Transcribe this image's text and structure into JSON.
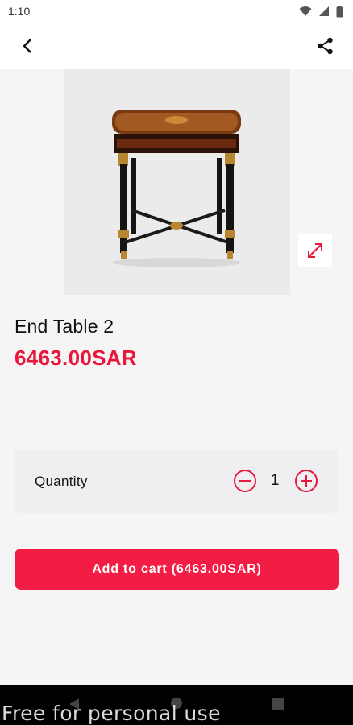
{
  "status_bar": {
    "time": "1:10"
  },
  "product": {
    "name": "End Table 2",
    "price": "6463.00SAR"
  },
  "quantity": {
    "label": "Quantity",
    "value": "1"
  },
  "cart": {
    "button_label": "Add to cart (6463.00SAR)"
  },
  "watermark": "Free for personal use",
  "colors": {
    "accent": "#e8173c",
    "button": "#f31c45"
  }
}
